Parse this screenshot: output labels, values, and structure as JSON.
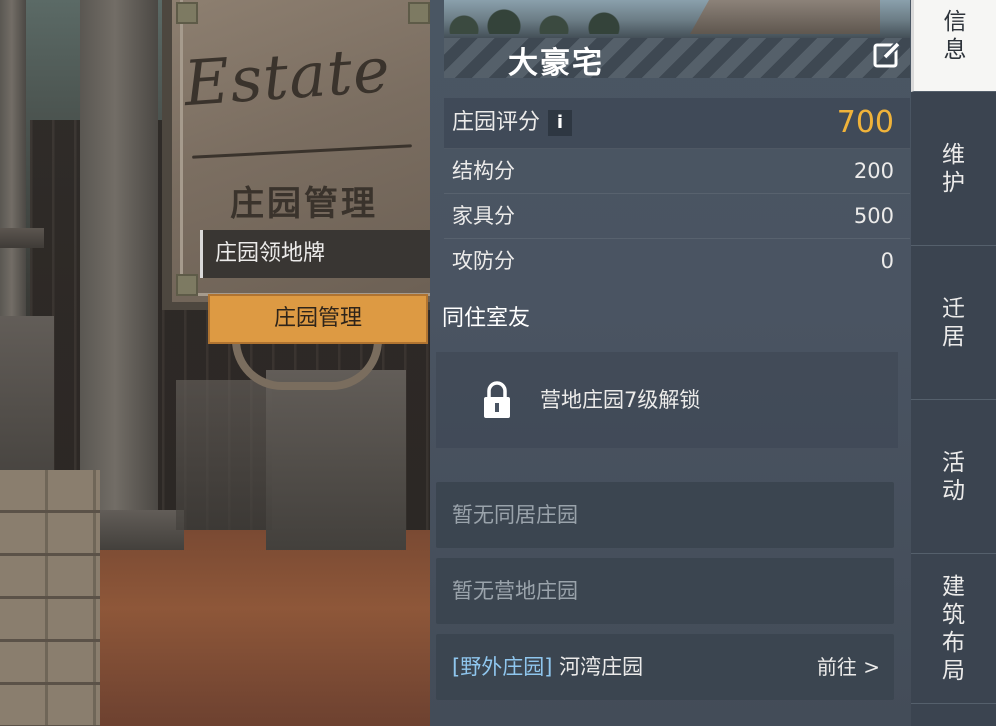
{
  "scene": {
    "board_script": "Estate",
    "board_title": "庄园管理",
    "plaque_label": "庄园领地牌",
    "plaque_button": "庄园管理"
  },
  "panel": {
    "estate_name": "大豪宅",
    "edit_icon": "edit-icon",
    "rating": {
      "label": "庄园评分",
      "info": "i",
      "value": "700"
    },
    "scores": [
      {
        "label": "结构分",
        "value": "200"
      },
      {
        "label": "家具分",
        "value": "500"
      },
      {
        "label": "攻防分",
        "value": "0"
      }
    ],
    "roommates_title": "同住室友",
    "lock_text": "营地庄园7级解锁",
    "lock_icon": "lock-icon",
    "empty_cohab": "暂无同居庄园",
    "empty_camp": "暂无营地庄园",
    "wild": {
      "tag": "[野外庄园]",
      "name": "河湾庄园",
      "go": "前往 >"
    }
  },
  "tabs": [
    "信息",
    "维护",
    "迁居",
    "活动",
    "建筑布局"
  ],
  "colors": {
    "accent": "#f0b33a",
    "button": "#dd9a43",
    "tag": "#8fc6ee",
    "panel": "#4a5462"
  }
}
